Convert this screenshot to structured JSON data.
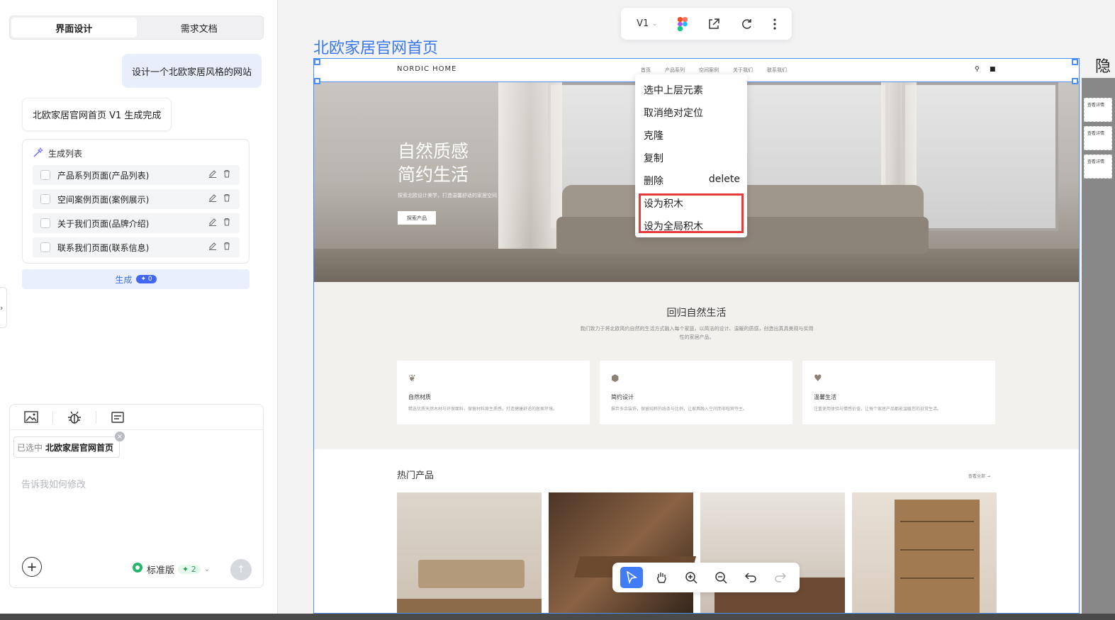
{
  "left_panel": {
    "tabs": [
      "界面设计",
      "需求文档"
    ],
    "user_message": "设计一个北欧家居风格的网站",
    "bot_message": "北欧家居官网首页 V1 生成完成",
    "gen_list": {
      "title": "生成列表",
      "items": [
        "产品系列页面(产品列表)",
        "空间案例页面(案例展示)",
        "关于我们页面(品牌介绍)",
        "联系我们页面(联系信息)"
      ]
    },
    "generate_button": {
      "label": "生成",
      "count": "✦ 0"
    },
    "composer": {
      "chip_prefix": "已选中",
      "chip_name": "北欧家居官网首页",
      "placeholder": "告诉我如何修改",
      "version_label": "标准版",
      "version_badge": "✦ 2"
    }
  },
  "topbar": {
    "version": "V1"
  },
  "canvas": {
    "page_title": "北欧家居官网首页",
    "site": {
      "brand": "NORDIC HOME",
      "nav": [
        "首页",
        "产品系列",
        "空间案例",
        "关于我们",
        "联系我们"
      ],
      "hero_title_1": "自然质感",
      "hero_title_2": "简约生活",
      "hero_sub": "探索北欧设计美学，打造温馨舒适的家居空间",
      "hero_button": "探索产品",
      "section_title": "回归自然生活",
      "section_desc": "我们致力于将北欧简约自然的生活方式融入每个家庭，以简洁的设计、温暖的质感，创造出真具美观与实用性的家居产品。",
      "features": [
        {
          "title": "自然材质",
          "desc": "精选优质天然木材与环保面料，保留材料原生质感，打造健康舒适的居家环境。"
        },
        {
          "title": "简约设计",
          "desc": "摒弃多余装饰，保留纯粹的线条与比例，让家具融入空间而非喧宾夺主。"
        },
        {
          "title": "温馨生活",
          "desc": "注重使用体验与情感价值，让每个家居产品都能温暖您的日常生活。"
        }
      ],
      "products_title": "热门产品",
      "products_more": "查看全部 →"
    }
  },
  "context_menu": {
    "items": [
      "选中上层元素",
      "取消绝对定位",
      "克隆",
      "复制",
      "删除",
      "设为积木",
      "设为全局积木"
    ],
    "delete_shortcut": "delete"
  },
  "right_strip": {
    "label": "隐",
    "cards": [
      "查看详情",
      "查看详情",
      "查看详情"
    ]
  },
  "colors": {
    "accent": "#3f7cf6",
    "highlight": "#e53b3b",
    "title_blue": "#3a78e8"
  }
}
